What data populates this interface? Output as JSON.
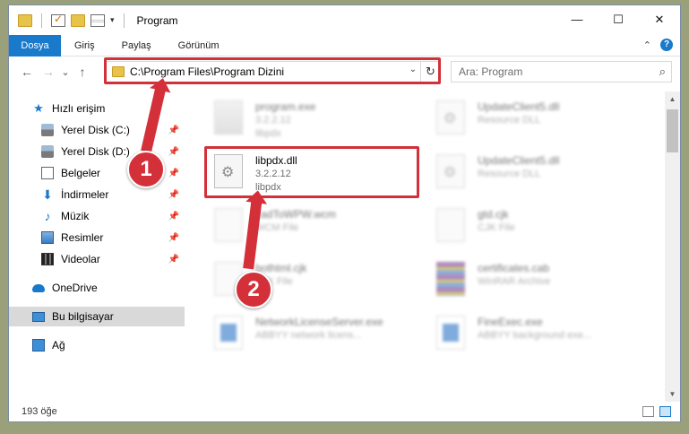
{
  "window": {
    "title": "Program",
    "controls": {
      "minimize": "—",
      "maximize": "☐",
      "close": "✕"
    }
  },
  "ribbon": {
    "tabs": [
      "Dosya",
      "Giriş",
      "Paylaş",
      "Görünüm"
    ],
    "expand": "⌃",
    "help": "?"
  },
  "nav": {
    "back": "←",
    "forward": "→",
    "recent": "⌄",
    "up": "↑",
    "address": "C:\\Program Files\\Program Dizini",
    "refresh": "↻",
    "search_placeholder": "Ara: Program",
    "search_icon": "search-icon"
  },
  "sidebar": {
    "items": [
      {
        "label": "Hızlı erişim",
        "icon": "star-icon"
      },
      {
        "label": "Yerel Disk (C:)",
        "icon": "disk-icon",
        "pinned": true
      },
      {
        "label": "Yerel Disk (D:)",
        "icon": "disk-icon",
        "pinned": true
      },
      {
        "label": "Belgeler",
        "icon": "document-icon",
        "pinned": true
      },
      {
        "label": "İndirmeler",
        "icon": "download-icon",
        "pinned": true
      },
      {
        "label": "Müzik",
        "icon": "music-icon",
        "pinned": true
      },
      {
        "label": "Resimler",
        "icon": "pictures-icon",
        "pinned": true
      },
      {
        "label": "Videolar",
        "icon": "videos-icon",
        "pinned": true
      },
      {
        "label": "OneDrive",
        "icon": "cloud-icon"
      },
      {
        "label": "Bu bilgisayar",
        "icon": "pc-icon",
        "selected": true
      },
      {
        "label": "Ağ",
        "icon": "network-icon"
      }
    ],
    "pin_glyph": "📌"
  },
  "files": [
    {
      "name": "program.exe",
      "line2": "3.2.2.12",
      "line3": "libpdx",
      "faded": true
    },
    {
      "name": "UpdateClient5.dll",
      "line2": "Resource DLL",
      "line3": "",
      "faded": true
    },
    {
      "name": "libpdx.dll",
      "line2": "3.2.2.12",
      "line3": "libpdx",
      "faded": false
    },
    {
      "name": "UpdateClient5.dll",
      "line2": "Resource DLL",
      "line3": "",
      "faded": true
    },
    {
      "name": "cadToWPW.wcm",
      "line2": "WCM File",
      "line3": "",
      "faded": true
    },
    {
      "name": "gtd.cjk",
      "line2": "CJK File",
      "line3": "",
      "faded": true
    },
    {
      "name": "bothtml.cjk",
      "line2": "CJK File",
      "line3": "",
      "faded": true
    },
    {
      "name": "certificates.cab",
      "line2": "WinRAR Archive",
      "line3": "",
      "faded": true
    },
    {
      "name": "NetworkLicenseServer.exe",
      "line2": "ABBYY network licens...",
      "line3": "",
      "faded": true
    },
    {
      "name": "FineExec.exe",
      "line2": "ABBYY background exe...",
      "line3": "",
      "faded": true
    }
  ],
  "status": {
    "count": "193 öğe"
  },
  "annotations": {
    "badge1": "1",
    "badge2": "2"
  },
  "colors": {
    "accent": "#1979ca",
    "annotation": "#d3303a"
  }
}
